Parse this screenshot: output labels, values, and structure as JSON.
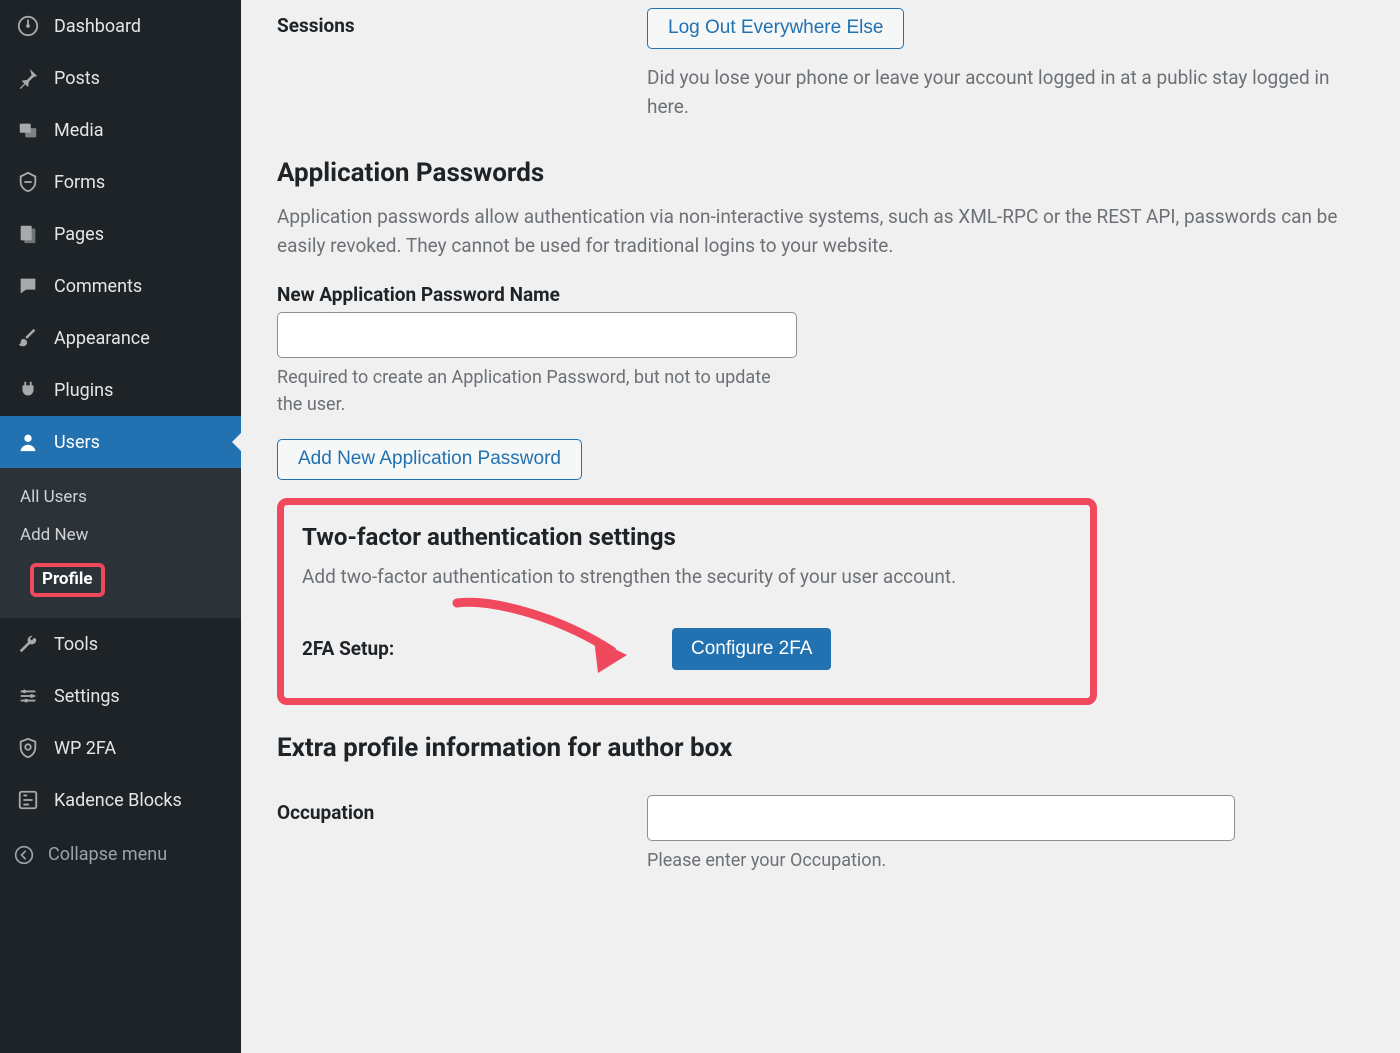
{
  "sidebar": {
    "items": [
      {
        "label": "Dashboard",
        "icon": "dashboard-icon",
        "active": false
      },
      {
        "label": "Posts",
        "icon": "pin-icon",
        "active": false
      },
      {
        "label": "Media",
        "icon": "media-icon",
        "active": false
      },
      {
        "label": "Forms",
        "icon": "forms-icon",
        "active": false
      },
      {
        "label": "Pages",
        "icon": "pages-icon",
        "active": false
      },
      {
        "label": "Comments",
        "icon": "comment-icon",
        "active": false
      },
      {
        "label": "Appearance",
        "icon": "brush-icon",
        "active": false
      },
      {
        "label": "Plugins",
        "icon": "plugin-icon",
        "active": false
      },
      {
        "label": "Users",
        "icon": "user-icon",
        "active": true
      },
      {
        "label": "Tools",
        "icon": "wrench-icon",
        "active": false
      },
      {
        "label": "Settings",
        "icon": "settings-icon",
        "active": false
      },
      {
        "label": "WP 2FA",
        "icon": "shield-icon",
        "active": false
      },
      {
        "label": "Kadence Blocks",
        "icon": "kadence-icon",
        "active": false
      }
    ],
    "submenu": {
      "items": [
        {
          "label": "All Users",
          "current": false
        },
        {
          "label": "Add New",
          "current": false
        },
        {
          "label": "Profile",
          "current": true
        }
      ]
    },
    "collapse_label": "Collapse menu"
  },
  "sessions": {
    "heading": "Sessions",
    "button": "Log Out Everywhere Else",
    "description": "Did you lose your phone or leave your account logged in at a public stay logged in here."
  },
  "app_passwords": {
    "heading": "Application Passwords",
    "description": "Application passwords allow authentication via non-interactive systems, such as XML-RPC or the REST API, passwords can be easily revoked. They cannot be used for traditional logins to your website.",
    "name_label": "New Application Password Name",
    "name_value": "",
    "name_helper": "Required to create an Application Password, but not to update the user.",
    "add_button": "Add New Application Password"
  },
  "twofa": {
    "heading": "Two-factor authentication settings",
    "description": "Add two-factor authentication to strengthen the security of your user account.",
    "setup_label": "2FA Setup:",
    "configure_button": "Configure 2FA"
  },
  "author_box": {
    "heading": "Extra profile information for author box",
    "occupation_label": "Occupation",
    "occupation_value": "",
    "occupation_helper": "Please enter your Occupation."
  }
}
